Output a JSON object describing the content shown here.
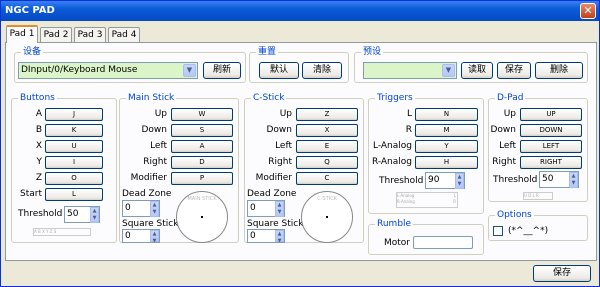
{
  "window": {
    "title": "NGC PAD",
    "close_glyph": "✕"
  },
  "tabs": [
    {
      "label": "Pad 1"
    },
    {
      "label": "Pad 2"
    },
    {
      "label": "Pad 3"
    },
    {
      "label": "Pad 4"
    }
  ],
  "device": {
    "title": "设备",
    "value": "DInput/0/Keyboard Mouse",
    "refresh": "刷新"
  },
  "reset": {
    "title": "重置",
    "default": "默认",
    "clear": "清除"
  },
  "preset": {
    "title": "预设",
    "value": "",
    "load": "读取",
    "save": "保存",
    "delete": "删除"
  },
  "buttons": {
    "title": "Buttons",
    "rows": [
      {
        "label": "A",
        "key": "J"
      },
      {
        "label": "B",
        "key": "K"
      },
      {
        "label": "X",
        "key": "U"
      },
      {
        "label": "Y",
        "key": "I"
      },
      {
        "label": "Z",
        "key": "O"
      },
      {
        "label": "Start",
        "key": "L"
      }
    ],
    "threshold_label": "Threshold",
    "threshold": "50",
    "mini": "A B X Y Z S"
  },
  "main_stick": {
    "title": "Main Stick",
    "rows": [
      {
        "label": "Up",
        "key": "W"
      },
      {
        "label": "Down",
        "key": "S"
      },
      {
        "label": "Left",
        "key": "A"
      },
      {
        "label": "Right",
        "key": "D"
      },
      {
        "label": "Modifier",
        "key": "P"
      }
    ],
    "deadzone_label": "Dead Zone",
    "deadzone": "0",
    "square_label": "Square Stick",
    "square": "0",
    "circle_label": "MAIN STICK"
  },
  "c_stick": {
    "title": "C-Stick",
    "rows": [
      {
        "label": "Up",
        "key": "Z"
      },
      {
        "label": "Down",
        "key": "X"
      },
      {
        "label": "Left",
        "key": "E"
      },
      {
        "label": "Right",
        "key": "Q"
      },
      {
        "label": "Modifier",
        "key": "C"
      }
    ],
    "deadzone_label": "Dead Zone",
    "deadzone": "0",
    "square_label": "Square Stick",
    "square": "0",
    "circle_label": "C-STICK"
  },
  "triggers": {
    "title": "Triggers",
    "rows": [
      {
        "label": "L",
        "key": "N"
      },
      {
        "label": "R",
        "key": "M"
      },
      {
        "label": "L-Analog",
        "key": "Y"
      },
      {
        "label": "R-Analog",
        "key": "H"
      }
    ],
    "threshold_label": "Threshold",
    "threshold": "90",
    "mini_l": "L-Analog",
    "mini_r": "R-Analog",
    "mini_lk": "L",
    "mini_rk": "R"
  },
  "rumble": {
    "title": "Rumble",
    "motor_label": "Motor"
  },
  "dpad": {
    "title": "D-Pad",
    "rows": [
      {
        "label": "Up",
        "key": "UP"
      },
      {
        "label": "Down",
        "key": "DOWN"
      },
      {
        "label": "Left",
        "key": "LEFT"
      },
      {
        "label": "Right",
        "key": "RIGHT"
      }
    ],
    "threshold_label": "Threshold",
    "threshold": "50",
    "mini": "U D L R"
  },
  "options": {
    "title": "Options",
    "checkbox_label": "(*^__^*)"
  },
  "footer": {
    "save": "保存"
  },
  "colors": {
    "title_bar": "#0a5bd8",
    "group_title": "#0046d5",
    "selected_combo": "#dbf5c8",
    "tab_accent": "#e68b2c"
  }
}
